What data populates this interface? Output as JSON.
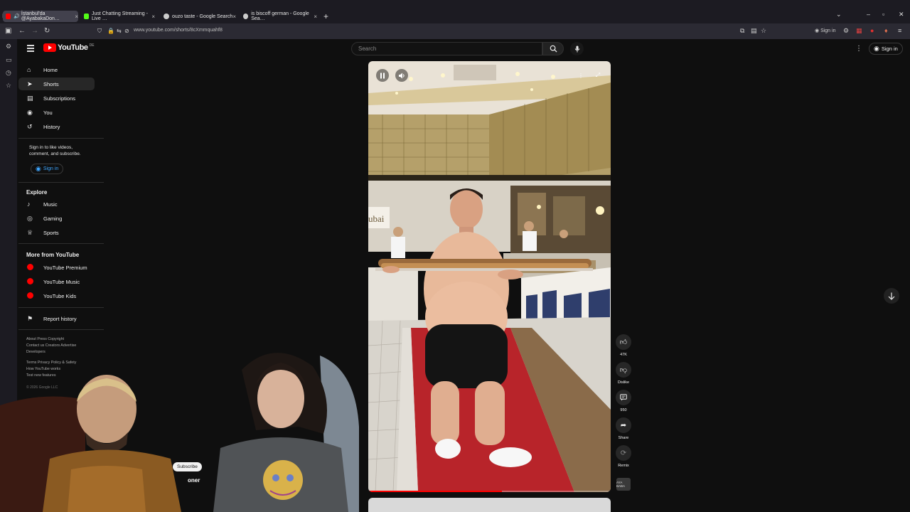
{
  "browser": {
    "tabs": [
      {
        "title": "İstanbul'da @AyabakaDon…",
        "favicon_color": "#ff0000",
        "active": true
      },
      {
        "title": "Just Chatting Streaming - Live …",
        "favicon_color": "#53fc18",
        "active": false
      },
      {
        "title": "ouzo taste - Google Search",
        "favicon_color": "#cccccc",
        "active": false
      },
      {
        "title": "is biscoff german - Google Sea…",
        "favicon_color": "#cccccc",
        "active": false
      }
    ],
    "close_glyph": "×",
    "new_tab_glyph": "+",
    "url": "www.youtube.com/shorts/8cXmmquahf8",
    "signin": "Sign in"
  },
  "masthead": {
    "logo_text": "YouTube",
    "logo_suffix": "DE",
    "search_placeholder": "Search",
    "signin": "Sign in"
  },
  "sidebar": {
    "main": [
      {
        "label": "Home",
        "icon": "home-icon",
        "glyph": "⌂"
      },
      {
        "label": "Shorts",
        "icon": "shorts-icon",
        "glyph": "➤",
        "active": true
      },
      {
        "label": "Subscriptions",
        "icon": "subscriptions-icon",
        "glyph": "▤"
      },
      {
        "label": "You",
        "icon": "you-icon",
        "glyph": "◉"
      },
      {
        "label": "History",
        "icon": "history-icon",
        "glyph": "↺"
      }
    ],
    "signin_prompt": "Sign in to like videos, comment, and subscribe.",
    "signin_button": "Sign in",
    "explore_title": "Explore",
    "explore": [
      {
        "label": "Music",
        "icon": "music-icon",
        "glyph": "♪"
      },
      {
        "label": "Gaming",
        "icon": "gaming-icon",
        "glyph": "◎"
      },
      {
        "label": "Sports",
        "icon": "sports-icon",
        "glyph": "♕"
      }
    ],
    "more_title": "More from YouTube",
    "more": [
      {
        "label": "YouTube Premium"
      },
      {
        "label": "YouTube Music"
      },
      {
        "label": "YouTube Kids"
      }
    ],
    "report_history": "Report history",
    "footer_1": "About  Press  Copyright",
    "footer_2": "Contact us  Creators  Advertise",
    "footer_3": "Developers",
    "footer_4": "Terms  Privacy  Policy & Safety",
    "footer_5": "How YouTube works",
    "footer_6": "Test new features",
    "copyright": "© 2026 Google LLC"
  },
  "actions": {
    "likes": "47K",
    "dislike": "Dislike",
    "comments": "950",
    "share": "Share",
    "remix": "Remix",
    "channel_avatar_text": "AYA BABA"
  },
  "video": {
    "progress": 0.55,
    "storefront_text": "ubai",
    "colors": {
      "brand": "#ff0000",
      "progress": "#ff0000",
      "link": "#3ea6ff"
    }
  },
  "webcam": {
    "subscribe_text": "Subscribe",
    "name_fragment": "oner"
  }
}
